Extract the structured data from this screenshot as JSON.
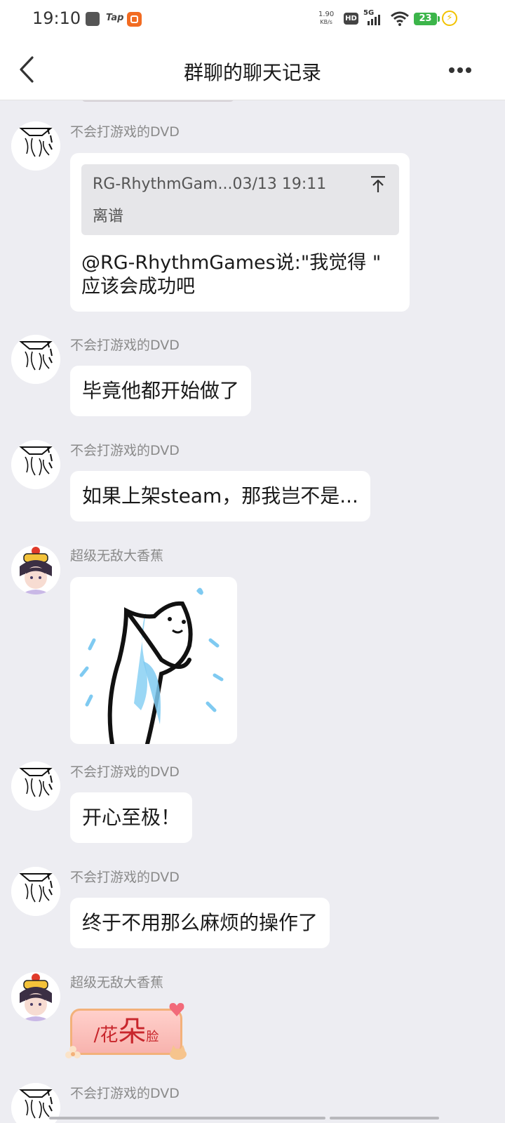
{
  "status_bar": {
    "time": "19:10",
    "app_icons": [
      "square-app-icon",
      "tap-app-icon",
      "orange-app-icon"
    ],
    "tap_label": "Tap",
    "net_speed_value": "1.90",
    "net_speed_unit": "KB/s",
    "hd_label": "HD",
    "network_label": "5G",
    "battery_level": "23",
    "charging_icon": "lightning-icon"
  },
  "header": {
    "title": "群聊的聊天记录",
    "back_icon": "chevron-left-icon",
    "more_icon": "more-dots-icon"
  },
  "colors": {
    "background": "#ededf2",
    "bubble": "#ffffff",
    "sender_name": "#8a8a8a",
    "quote_box": "#e6e6e9",
    "battery": "#3cb54a",
    "charge": "#f2c200"
  },
  "messages": [
    {
      "sender": "不会打游戏的DVD",
      "type": "quote",
      "quote_meta": "RG-RhythmGam...03/13 19:11",
      "quote_text": "离谱",
      "body_line1": "@RG-RhythmGames说:\"我觉得 \"",
      "body_line2": "应该会成功吧"
    },
    {
      "sender": "不会打游戏的DVD",
      "type": "text",
      "text": "毕竟他都开始做了"
    },
    {
      "sender": "不会打游戏的DVD",
      "type": "text",
      "text": "如果上架steam，那我岂不是..."
    },
    {
      "sender": "超级无敌大香蕉",
      "type": "sticker",
      "sticker_icon": "sweating-cat-sticker-icon"
    },
    {
      "sender": "不会打游戏的DVD",
      "type": "text",
      "text": "开心至极！"
    },
    {
      "sender": "不会打游戏的DVD",
      "type": "text",
      "text": "终于不用那么麻烦的操作了"
    },
    {
      "sender": "超级无敌大香蕉",
      "type": "emoji",
      "emoji_part1": "/花",
      "emoji_part2": "朵",
      "emoji_part3": "脸"
    },
    {
      "sender": "不会打游戏的DVD",
      "type": "partial"
    }
  ]
}
